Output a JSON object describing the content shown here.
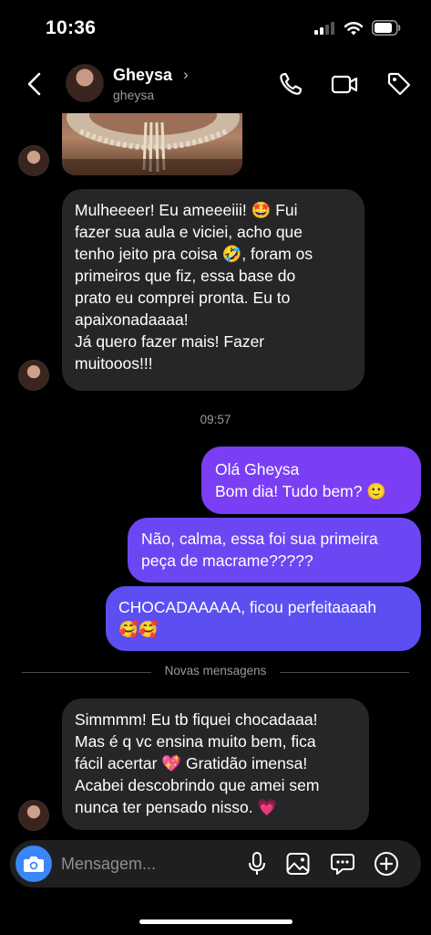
{
  "status_bar": {
    "time": "10:36"
  },
  "header": {
    "name": "Gheysa",
    "chevron": "›",
    "username": "gheysa",
    "icons": [
      "back-chevron-icon",
      "phone-icon",
      "video-camera-icon",
      "tag-icon"
    ]
  },
  "messages": {
    "received_1": {
      "lines": [
        "Mulheeeer! Eu ameeeiii! 🤩 Fui",
        "fazer sua aula e viciei, acho que",
        "tenho jeito pra coisa 🤣, foram os",
        "primeiros que fiz, essa base do",
        "prato eu comprei pronta. Eu to",
        "apaixonadaaaa!",
        "Já quero fazer mais! Fazer",
        "muitooos!!!"
      ]
    },
    "timestamp": "09:57",
    "sent_1": {
      "lines": [
        "Olá Gheysa",
        "Bom dia! Tudo bem? 🙂"
      ]
    },
    "sent_2": {
      "lines": [
        "Não, calma, essa foi sua primeira",
        "peça de macrame?????"
      ]
    },
    "sent_3": {
      "lines": [
        "CHOCADAAAAA, ficou perfeitaaaah",
        "🥰🥰"
      ]
    },
    "new_messages_divider": "Novas mensagens",
    "received_2": {
      "lines": [
        "Simmmm! Eu tb fiquei chocadaaa!",
        "Mas é q vc ensina muito bem, fica",
        "fácil acertar 💖 Gratidão imensa!",
        "Acabei descobrindo que amei sem",
        "nunca ter pensado nisso. 💗"
      ]
    }
  },
  "composer": {
    "placeholder": "Mensagem...",
    "icons": [
      "camera-icon",
      "microphone-icon",
      "gallery-icon",
      "sticker-icon",
      "plus-icon"
    ]
  },
  "colors": {
    "background": "#000000",
    "received_bubble": "#262628",
    "sent_gradient_top": "#7a3ef5",
    "sent_gradient_bottom": "#5b4ff2",
    "camera_button": "#3a86f6"
  }
}
